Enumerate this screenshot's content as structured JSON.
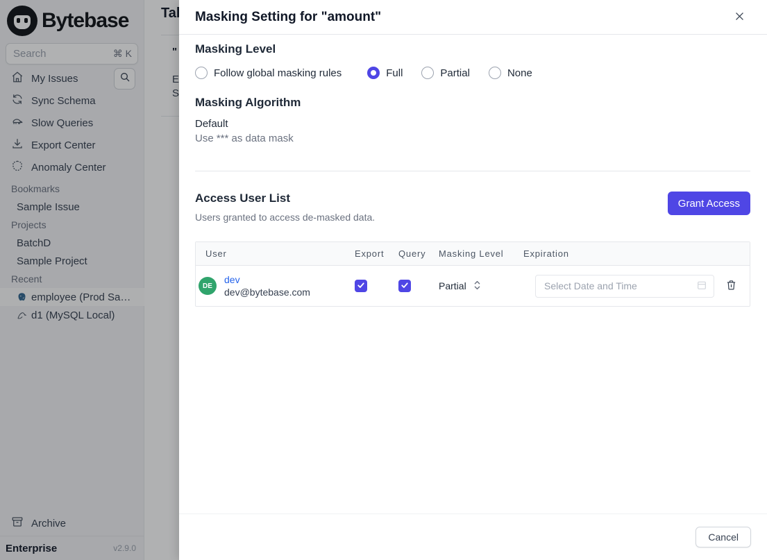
{
  "sidebar": {
    "logo_text": "Bytebase",
    "search": {
      "placeholder": "Search",
      "shortcut": "⌘ K"
    },
    "nav": [
      {
        "icon": "home-icon",
        "label": "My Issues"
      },
      {
        "icon": "sync-icon",
        "label": "Sync Schema"
      },
      {
        "icon": "turtle-icon",
        "label": "Slow Queries"
      },
      {
        "icon": "download-icon",
        "label": "Export Center"
      },
      {
        "icon": "shield-icon",
        "label": "Anomaly Center"
      }
    ],
    "sections": {
      "bookmarks": {
        "title": "Bookmarks",
        "item0": "Sample Issue"
      },
      "projects": {
        "title": "Projects",
        "item0": "BatchD",
        "item1": "Sample Project"
      },
      "recent": {
        "title": "Recent",
        "item0": "employee (Prod Sam…",
        "item0_icon": "postgresql-icon",
        "item1": "d1 (MySQL Local)",
        "item1_icon": "mysql-icon"
      }
    },
    "archive_label": "Archive",
    "plan": "Enterprise",
    "version": "v2.9.0"
  },
  "background_page": {
    "heading_partial": "Tab",
    "fragments": [
      "\"",
      "E",
      "S"
    ]
  },
  "modal": {
    "title": "Masking Setting for \"amount\"",
    "masking_level": {
      "heading": "Masking Level",
      "options": [
        {
          "label": "Follow global masking rules",
          "selected": false
        },
        {
          "label": "Full",
          "selected": true
        },
        {
          "label": "Partial",
          "selected": false
        },
        {
          "label": "None",
          "selected": false
        }
      ]
    },
    "masking_algorithm": {
      "heading": "Masking Algorithm",
      "name": "Default",
      "description": "Use *** as data mask"
    },
    "access": {
      "heading": "Access User List",
      "subtitle": "Users granted to access de-masked data.",
      "grant_button": "Grant Access",
      "table": {
        "columns": [
          "User",
          "Export",
          "Query",
          "Masking Level",
          "Expiration"
        ],
        "rows": [
          {
            "avatar_initials": "DE",
            "name": "dev",
            "email": "dev@bytebase.com",
            "export_checked": true,
            "query_checked": true,
            "masking_level": "Partial",
            "expiration_value": "",
            "expiration_placeholder": "Select Date and Time"
          }
        ]
      }
    },
    "footer": {
      "cancel_label": "Cancel"
    }
  },
  "colors": {
    "accent": "#4f46e5",
    "link": "#2563eb",
    "avatar_green": "#30a46c"
  }
}
